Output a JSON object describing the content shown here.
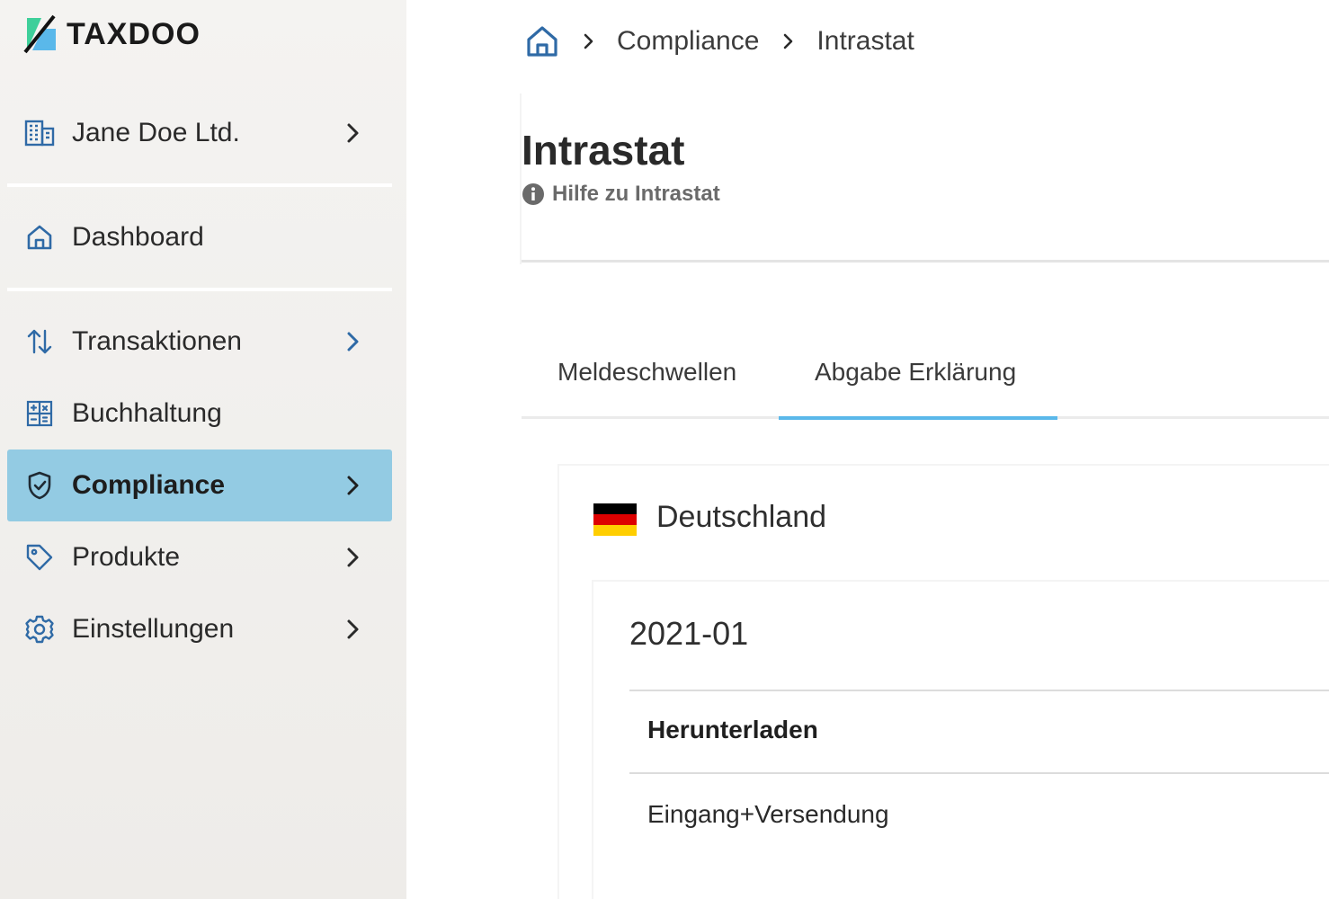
{
  "brand": {
    "name": "TAXDOO"
  },
  "sidebar": {
    "company": {
      "label": "Jane Doe Ltd.",
      "icon": "building-icon"
    },
    "items": [
      {
        "key": "dashboard",
        "label": "Dashboard",
        "icon": "home-icon",
        "active": false,
        "has_children": false
      },
      {
        "key": "transaktionen",
        "label": "Transaktionen",
        "icon": "arrows-up-down-icon",
        "active": false,
        "has_children": true
      },
      {
        "key": "buchhaltung",
        "label": "Buchhaltung",
        "icon": "calculator-icon",
        "active": false,
        "has_children": false
      },
      {
        "key": "compliance",
        "label": "Compliance",
        "icon": "shield-check-icon",
        "active": true,
        "has_children": true
      },
      {
        "key": "produkte",
        "label": "Produkte",
        "icon": "tag-icon",
        "active": false,
        "has_children": true
      },
      {
        "key": "einstellungen",
        "label": "Einstellungen",
        "icon": "gear-icon",
        "active": false,
        "has_children": true
      }
    ]
  },
  "breadcrumb": {
    "home_icon": "home-icon",
    "items": [
      "Compliance",
      "Intrastat"
    ]
  },
  "page": {
    "title": "Intrastat",
    "help_label": "Hilfe zu Intrastat",
    "help_icon": "info-icon"
  },
  "tabs": [
    {
      "label": "Meldeschwellen",
      "active": false
    },
    {
      "label": "Abgabe Erklärung",
      "active": true
    }
  ],
  "country": {
    "name": "Deutschland",
    "flag_icon": "germany-flag-icon"
  },
  "report": {
    "period": "2021-01",
    "column_header": "Herunterladen",
    "rows": [
      "Eingang+Versendung"
    ]
  },
  "colors": {
    "accent": "#5ab8ea",
    "active_nav_bg": "#93cbe3",
    "icon_blue": "#2f6aa6",
    "flag_black": "#000000",
    "flag_red": "#dd0000",
    "flag_gold": "#ffce00"
  }
}
